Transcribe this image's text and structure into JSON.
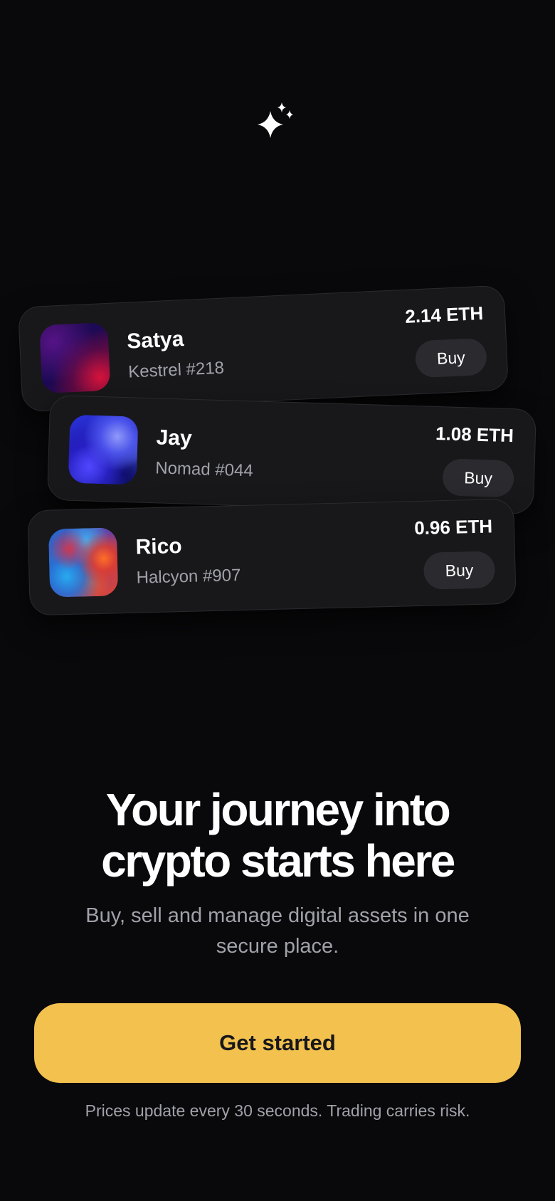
{
  "hero": {
    "icon": "sparkle-icon",
    "title_line1": "Your journey into",
    "title_line2": "crypto starts here",
    "subtitle": "Buy, sell and manage digital assets in one secure place."
  },
  "cards": [
    {
      "name": "Satya",
      "collection": "Kestrel #218",
      "price": "2.14 ETH",
      "buy_label": "Buy"
    },
    {
      "name": "Jay",
      "collection": "Nomad #044",
      "price": "1.08 ETH",
      "buy_label": "Buy"
    },
    {
      "name": "Rico",
      "collection": "Halcyon #907",
      "price": "0.96 ETH",
      "buy_label": "Buy"
    }
  ],
  "cta": {
    "label": "Get started"
  },
  "footer": {
    "disclaimer": "Prices update every 30 seconds. Trading carries risk."
  },
  "colors": {
    "background": "#09090b",
    "card": "#18181b",
    "accent": "#f2c14e",
    "muted_text": "#a1a1aa"
  }
}
